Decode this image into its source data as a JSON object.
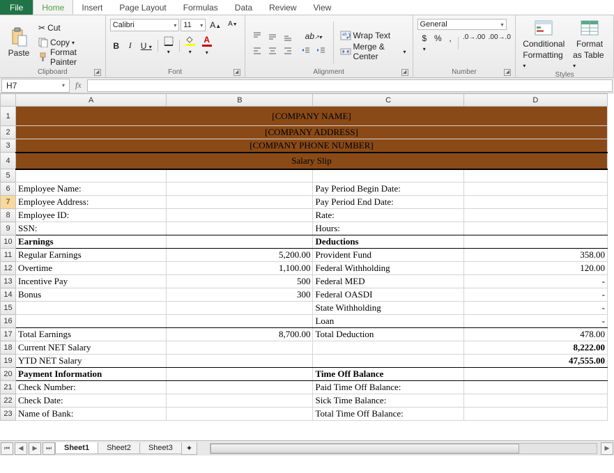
{
  "tabs": {
    "file": "File",
    "items": [
      "Home",
      "Insert",
      "Page Layout",
      "Formulas",
      "Data",
      "Review",
      "View"
    ],
    "active": 0
  },
  "ribbon": {
    "clipboard": {
      "paste": "Paste",
      "cut": "Cut",
      "copy": "Copy",
      "painter": "Format Painter",
      "title": "Clipboard"
    },
    "font": {
      "name": "Calibri",
      "size": "11",
      "title": "Font"
    },
    "alignment": {
      "wrap": "Wrap Text",
      "merge": "Merge & Center",
      "title": "Alignment"
    },
    "number": {
      "format": "General",
      "title": "Number"
    },
    "styles": {
      "cond": "Conditional",
      "cond2": "Formatting",
      "fmt": "Format",
      "fmt2": "as Table",
      "title": "Styles"
    }
  },
  "namebox": "H7",
  "columns": [
    "A",
    "B",
    "C",
    "D"
  ],
  "rows": {
    "1": {
      "merged": "[COMPANY NAME]"
    },
    "2": {
      "merged": "[COMPANY ADDRESS]"
    },
    "3": {
      "merged": "[COMPANY PHONE NUMBER]"
    },
    "4": {
      "merged": "Salary Slip"
    },
    "6": {
      "a": "Employee Name:",
      "c": "Pay Period Begin Date:"
    },
    "7": {
      "a": "Employee Address:",
      "c": "Pay Period End Date:"
    },
    "8": {
      "a": "Employee ID:",
      "c": "Rate:"
    },
    "9": {
      "a": "SSN:",
      "c": "Hours:"
    },
    "10": {
      "a": "Earnings",
      "c": "Deductions"
    },
    "11": {
      "a": "Regular Earnings",
      "b": "5,200.00",
      "c": "Provident Fund",
      "d": "358.00"
    },
    "12": {
      "a": "Overtime",
      "b": "1,100.00",
      "c": "Federal Withholding",
      "d": "120.00"
    },
    "13": {
      "a": "Incentive Pay",
      "b": "500",
      "c": "Federal MED",
      "d": "-"
    },
    "14": {
      "a": "Bonus",
      "b": "300",
      "c": "Federal OASDI",
      "d": "-"
    },
    "15": {
      "c": "State Withholding",
      "d": "-"
    },
    "16": {
      "c": "Loan",
      "d": "-"
    },
    "17": {
      "a": "Total Earnings",
      "b": "8,700.00",
      "c": "Total Deduction",
      "d": "478.00"
    },
    "18": {
      "a": "Current NET Salary",
      "d": "8,222.00"
    },
    "19": {
      "a": "YTD NET Salary",
      "d": "47,555.00"
    },
    "20": {
      "a": "Payment Information",
      "c": "Time Off Balance"
    },
    "21": {
      "a": "Check  Number:",
      "c": "Paid Time Off Balance:"
    },
    "22": {
      "a": "Check Date:",
      "c": "Sick Time Balance:"
    },
    "23": {
      "a": "Name of Bank:",
      "c": "Total Time Off Balance:"
    }
  },
  "sheets": [
    "Sheet1",
    "Sheet2",
    "Sheet3"
  ],
  "chart_data": {
    "type": "table",
    "title": "Salary Slip",
    "earnings": [
      {
        "label": "Regular Earnings",
        "value": 5200.0
      },
      {
        "label": "Overtime",
        "value": 1100.0
      },
      {
        "label": "Incentive Pay",
        "value": 500
      },
      {
        "label": "Bonus",
        "value": 300
      }
    ],
    "total_earnings": 8700.0,
    "deductions": [
      {
        "label": "Provident Fund",
        "value": 358.0
      },
      {
        "label": "Federal Withholding",
        "value": 120.0
      },
      {
        "label": "Federal MED",
        "value": null
      },
      {
        "label": "Federal OASDI",
        "value": null
      },
      {
        "label": "State Withholding",
        "value": null
      },
      {
        "label": "Loan",
        "value": null
      }
    ],
    "total_deduction": 478.0,
    "current_net_salary": 8222.0,
    "ytd_net_salary": 47555.0
  }
}
